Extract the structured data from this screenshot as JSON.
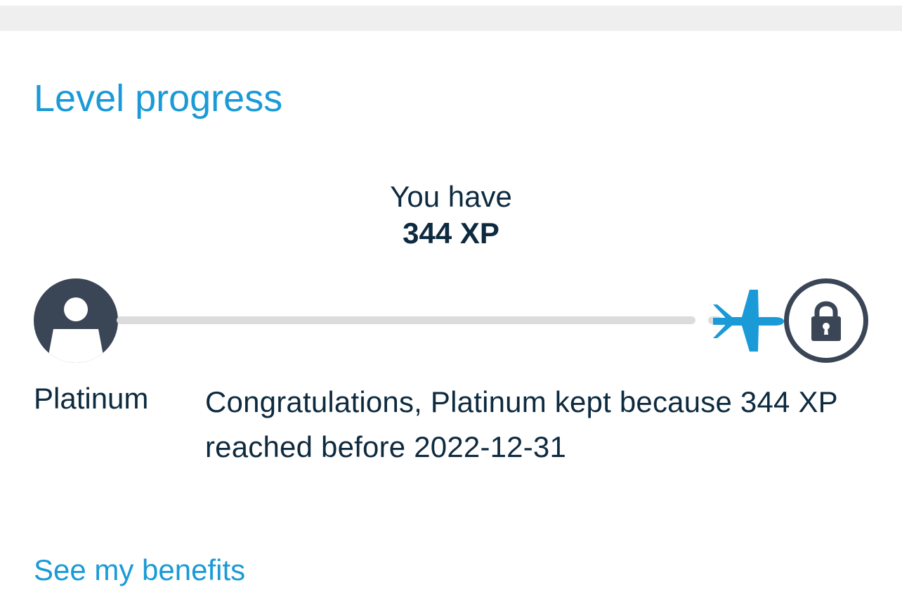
{
  "section": {
    "title": "Level progress"
  },
  "summary": {
    "intro": "You have",
    "xp": "344 XP"
  },
  "progress": {
    "current_level": "Platinum",
    "fraction_to_next_level": 1.0,
    "message": "Congratulations, Platinum kept because 344 XP reached before 2022-12-31"
  },
  "icons": {
    "current": "avatar-icon",
    "progress_marker": "airplane-icon",
    "next_level": "lock-icon"
  },
  "colors": {
    "accent": "#1a9ad6",
    "text": "#0e2a3f",
    "icon_dark": "#3a4556",
    "track": "#dcdcdc"
  },
  "links": {
    "benefits": "See my benefits"
  }
}
